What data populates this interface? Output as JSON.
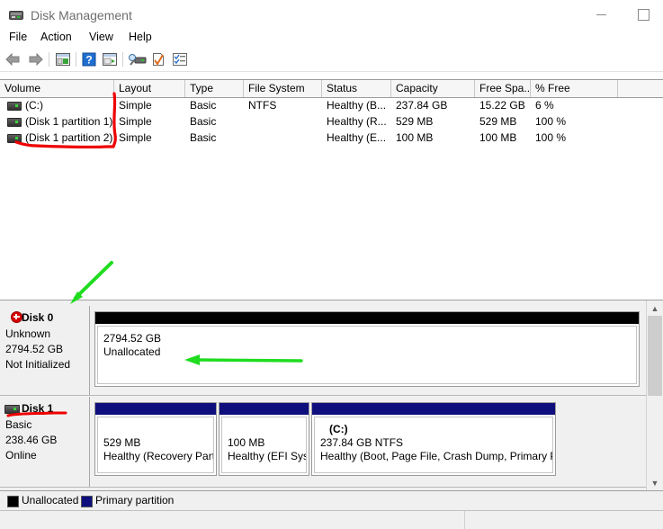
{
  "window": {
    "title": "Disk Management",
    "icon": "disk-management-icon",
    "buttons": {
      "minimize": "—",
      "maximize": "□",
      "close": "✕"
    }
  },
  "menu": {
    "items": [
      "File",
      "Action",
      "View",
      "Help"
    ]
  },
  "toolbar": {
    "items": [
      "back-arrow-icon",
      "forward-arrow-icon",
      "show-hide-console-tree-icon",
      "help-icon",
      "show-hide-action-pane-icon",
      "rescan-disks-icon",
      "properties-icon",
      "list-view-icon"
    ]
  },
  "volume_list": {
    "columns": [
      "Volume",
      "Layout",
      "Type",
      "File System",
      "Status",
      "Capacity",
      "Free Spa...",
      "% Free"
    ],
    "rows": [
      {
        "volume": "(C:)",
        "layout": "Simple",
        "type": "Basic",
        "filesystem": "NTFS",
        "status": "Healthy (B...",
        "capacity": "237.84 GB",
        "free": "15.22 GB",
        "percent": "6 %"
      },
      {
        "volume": "(Disk 1 partition 1)",
        "layout": "Simple",
        "type": "Basic",
        "filesystem": "",
        "status": "Healthy (R...",
        "capacity": "529 MB",
        "free": "529 MB",
        "percent": "100 %"
      },
      {
        "volume": "(Disk 1 partition 2)",
        "layout": "Simple",
        "type": "Basic",
        "filesystem": "",
        "status": "Healthy (E...",
        "capacity": "100 MB",
        "free": "100 MB",
        "percent": "100 %"
      }
    ]
  },
  "disks": [
    {
      "name": "Disk 0",
      "icon": "disk-error-icon",
      "lines": [
        "Unknown",
        "2794.52 GB",
        "Not Initialized"
      ],
      "partitions": [
        {
          "cap_color": "#000000",
          "size": "2794.52 GB",
          "status": "Unallocated",
          "label": ""
        }
      ]
    },
    {
      "name": "Disk 1",
      "icon": "disk-basic-icon",
      "lines": [
        "Basic",
        "238.46 GB",
        "Online"
      ],
      "partitions": [
        {
          "cap_color": "#0e0e7d",
          "size": "529 MB",
          "status": "Healthy (Recovery Parti",
          "label": ""
        },
        {
          "cap_color": "#0e0e7d",
          "size": "100 MB",
          "status": "Healthy (EFI Syst",
          "label": ""
        },
        {
          "cap_color": "#0e0e7d",
          "size": "237.84 GB NTFS",
          "status": "Healthy (Boot, Page File, Crash Dump, Primary Pa",
          "label": "(C:)"
        }
      ]
    }
  ],
  "legend": {
    "items": [
      {
        "label": "Unallocated",
        "color": "#000000"
      },
      {
        "label": "Primary partition",
        "color": "#0e0e7d"
      }
    ]
  },
  "annotations": {
    "red_color": "#ee0000",
    "green_color": "#1fdc1f",
    "marks": [
      "red-bracket-volume-column",
      "green-arrow-to-disk0",
      "green-arrow-to-unallocated",
      "red-underline-disk1"
    ]
  },
  "scrollbar": {
    "up": "▲",
    "down": "▼"
  }
}
